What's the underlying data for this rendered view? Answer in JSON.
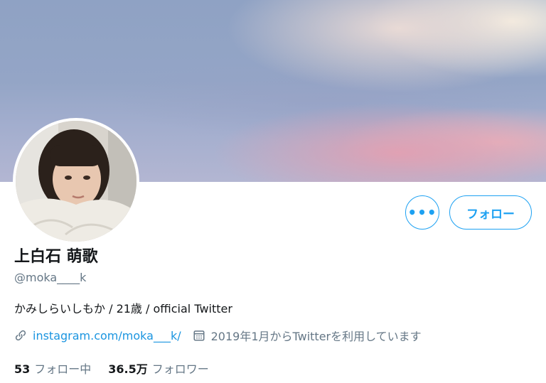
{
  "profile": {
    "display_name": "上白石 萌歌",
    "handle": "@moka____k",
    "bio": "かみしらいしもか / 21歳 / official Twitter",
    "link_text": "instagram.com/moka___k/",
    "joined": "2019年1月からTwitterを利用しています"
  },
  "actions": {
    "more_label": "•••",
    "follow_label": "フォロー"
  },
  "stats": {
    "following_count": "53",
    "following_label": "フォロー中",
    "followers_count": "36.5万",
    "followers_label": "フォロワー"
  },
  "icons": {
    "link": "link-icon",
    "calendar": "calendar-icon",
    "more": "more-icon"
  },
  "colors": {
    "accent": "#1da1f2",
    "link": "#1b95e0",
    "secondary_text": "#657786",
    "primary_text": "#14171a"
  }
}
